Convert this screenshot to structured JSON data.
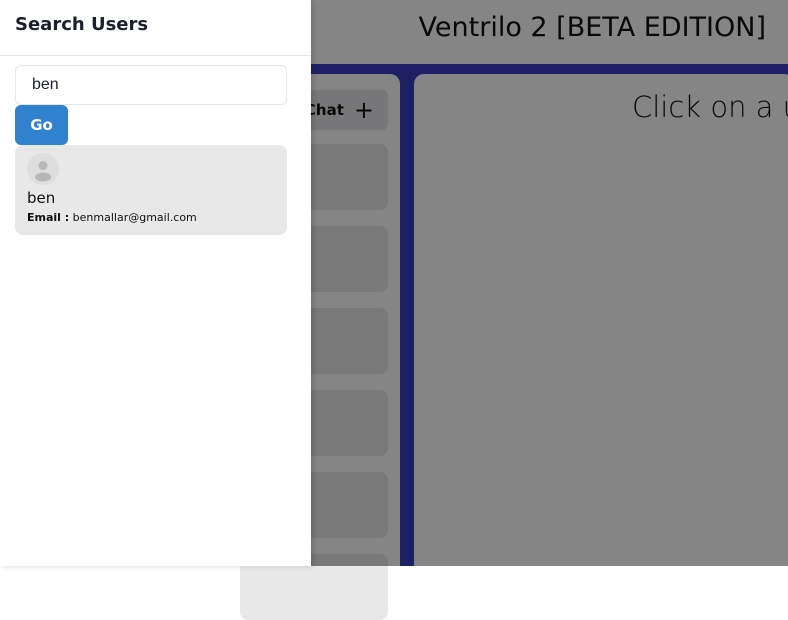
{
  "app": {
    "title": "Ventrilo 2 [BETA EDITION]",
    "new_chat_label": "Chat",
    "chat_placeholder": "Click on a u",
    "accent_color": "#3b3ec4"
  },
  "drawer": {
    "title": "Search Users",
    "search": {
      "value": "ben",
      "placeholder": ""
    },
    "go_label": "Go",
    "go_color": "#3182ce",
    "results": [
      {
        "name": "ben",
        "email_label": "Email :",
        "email": "benmallar@gmail.com",
        "avatar_icon": "default-user-icon"
      }
    ]
  }
}
